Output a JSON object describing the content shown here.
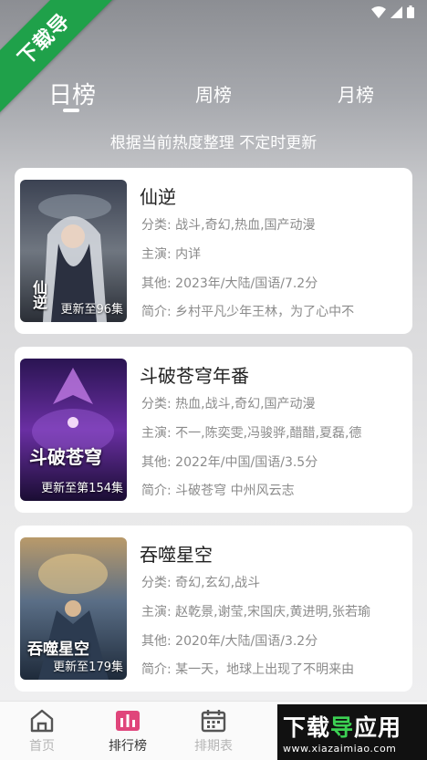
{
  "corner_ribbon": "下载导",
  "tabs": [
    {
      "label": "日榜",
      "active": true
    },
    {
      "label": "周榜",
      "active": false
    },
    {
      "label": "月榜",
      "active": false
    }
  ],
  "subtitle": "根据当前热度整理 不定时更新",
  "items": [
    {
      "title": "仙逆",
      "badge": "更新至96集",
      "poster_text": "仙逆",
      "category": "分类:  战斗,奇幻,热血,国产动漫",
      "cast": "主演:  内详",
      "other": "其他:  2023年/大陆/国语/7.2分",
      "intro": "简介:  乡村平凡少年王林，为了心中不"
    },
    {
      "title": "斗破苍穹年番",
      "badge": "更新至第154集",
      "poster_text": "斗破苍穹",
      "category": "分类:  热血,战斗,奇幻,国产动漫",
      "cast": "主演:  不一,陈奕雯,冯骏骅,醋醋,夏磊,德",
      "other": "其他:  2022年/中国/国语/3.5分",
      "intro": "简介:          斗破苍穹 中州风云志"
    },
    {
      "title": "吞噬星空",
      "badge": "更新至179集",
      "poster_text": "吞噬星空",
      "category": "分类:  奇幻,玄幻,战斗",
      "cast": "主演:  赵乾景,谢莹,宋国庆,黄进明,张若瑜",
      "other": "其他:  2020年/大陆/国语/3.2分",
      "intro": "简介:  某一天，地球上出现了不明来由"
    }
  ],
  "nav": [
    {
      "label": "首页",
      "icon": "home-icon",
      "active": false
    },
    {
      "label": "排行榜",
      "icon": "chart-icon",
      "active": true
    },
    {
      "label": "排期表",
      "icon": "calendar-icon",
      "active": false
    }
  ],
  "watermark": {
    "title_a": "下载",
    "title_b": "导",
    "title_c": "应用",
    "url": "www.xiazaimiao.com"
  },
  "colors": {
    "accent": "#e0457b",
    "ribbon": "#1fa14a"
  }
}
